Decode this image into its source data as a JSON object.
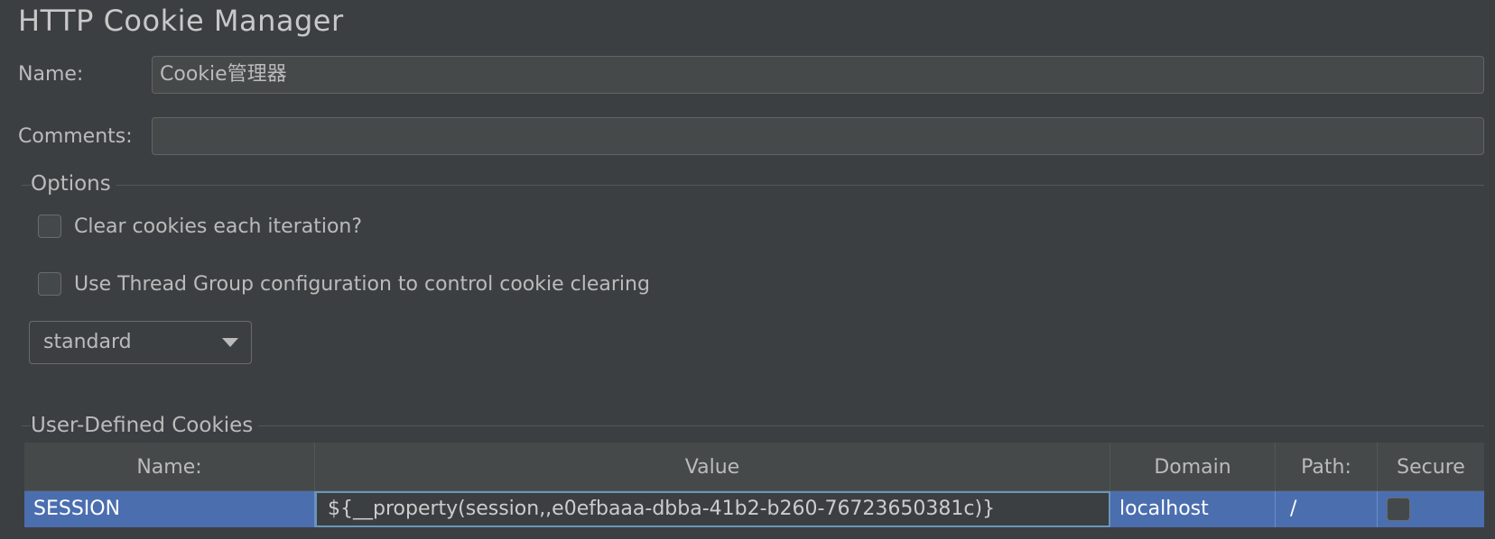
{
  "header": {
    "title": "HTTP Cookie Manager"
  },
  "form": {
    "name_label": "Name:",
    "name_value": "Cookie管理器",
    "comments_label": "Comments:",
    "comments_value": ""
  },
  "options": {
    "title": "Options",
    "clear_each_iteration": {
      "label": "Clear cookies each iteration?",
      "checked": false
    },
    "use_thread_group": {
      "label": "Use Thread Group configuration to control cookie clearing",
      "checked": false
    },
    "policy": {
      "selected": "standard"
    }
  },
  "cookies": {
    "title": "User-Defined Cookies",
    "columns": [
      "Name:",
      "Value",
      "Domain",
      "Path:",
      "Secure"
    ],
    "rows": [
      {
        "name": "SESSION",
        "value": "${__property(session,,e0efbaaa-dbba-41b2-b260-76723650381c)}",
        "domain": "localhost",
        "path": "/",
        "secure": false
      }
    ]
  },
  "colors": {
    "background": "#3c3f41",
    "field_bg": "#45494a",
    "selection": "#4b6eaf",
    "text": "#bbbbbb"
  }
}
